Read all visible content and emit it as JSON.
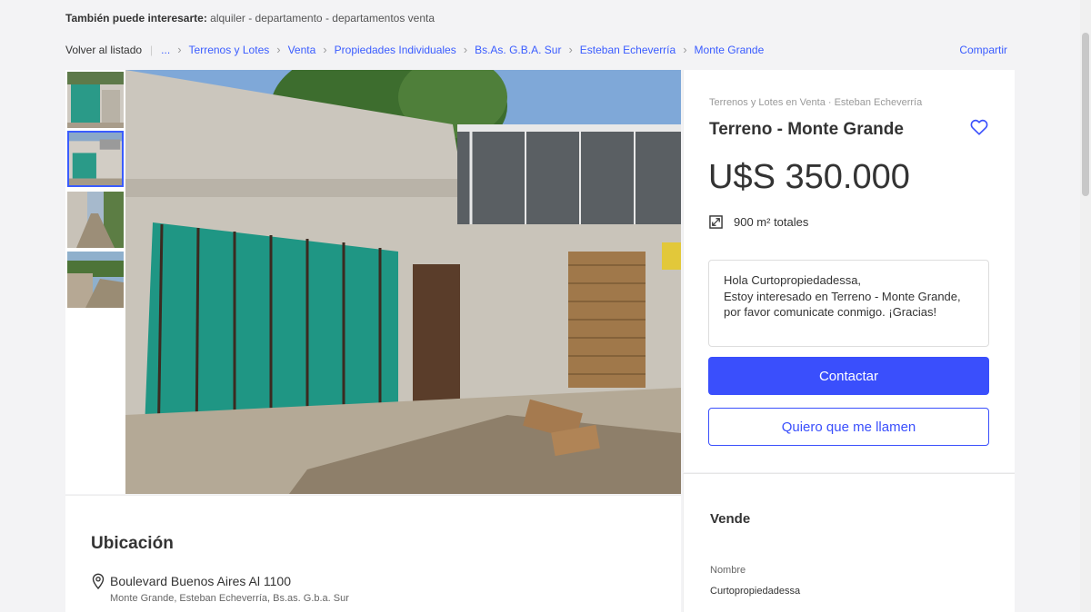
{
  "interest": {
    "label": "También puede interesarte:",
    "links": [
      "alquiler",
      "departamento",
      "departamentos venta"
    ],
    "separator": " - "
  },
  "breadcrumb": {
    "back": "Volver al listado",
    "items": [
      "...",
      "Terrenos y Lotes",
      "Venta",
      "Propiedades Individuales",
      "Bs.As. G.B.A. Sur",
      "Esteban Echeverría",
      "Monte Grande"
    ],
    "share": "Compartir"
  },
  "listing": {
    "subtitle": "Terrenos y Lotes en Venta · Esteban Echeverría",
    "title": "Terreno - Monte Grande",
    "price": "U$S 350.000",
    "area": "900 m² totales",
    "message": "Hola Curtopropiedadessa,\nEstoy interesado en Terreno - Monte Grande, por favor comunicate conmigo. ¡Gracias!",
    "contact_button": "Contactar",
    "call_button": "Quiero que me llamen"
  },
  "seller": {
    "title": "Vende",
    "name_label": "Nombre",
    "name": "Curtopropiedadessa"
  },
  "location": {
    "title": "Ubicación",
    "address": "Boulevard Buenos Aires Al 1100",
    "area": "Monte Grande, Esteban Echeverría, Bs.as. G.b.a. Sur"
  },
  "gallery": {
    "thumbnail_count": 4,
    "active_thumbnail": 2
  },
  "colors": {
    "accent": "#3a4ffc",
    "link": "#3a5cff",
    "background": "#f3f3f5"
  },
  "icons": [
    "heart-icon",
    "area-icon",
    "location-pin-icon"
  ]
}
